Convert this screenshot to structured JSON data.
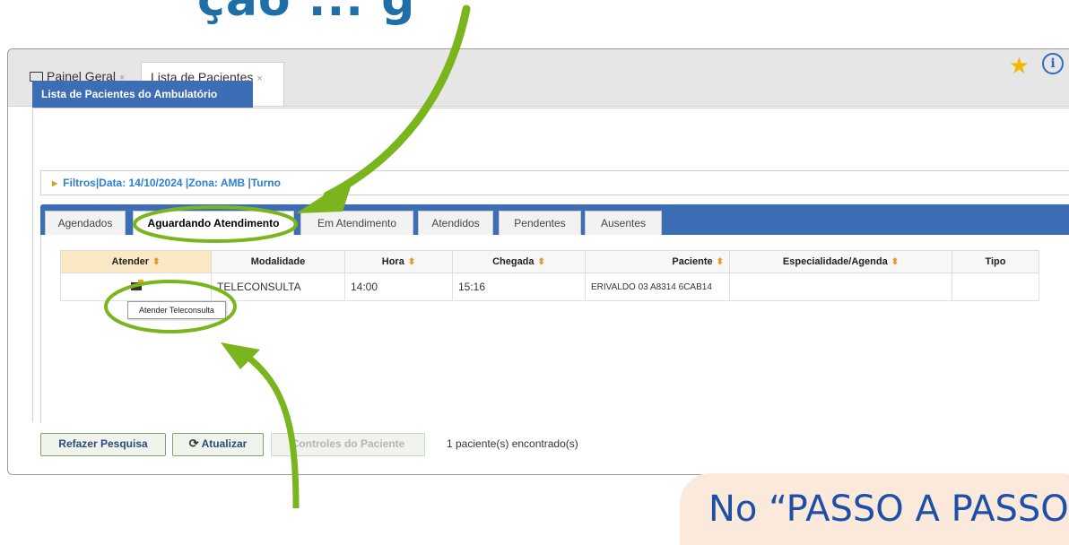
{
  "heading": {
    "text": "ção ... g"
  },
  "window_tabs": [
    {
      "label": "Painel Geral",
      "close": "×"
    },
    {
      "label": "Lista de Pacientes",
      "close": "×"
    }
  ],
  "panel": {
    "title": "Lista de Pacientes do Ambulatório",
    "filters": "Filtros|Data: 14/10/2024 |Zona: AMB |Turno"
  },
  "inner_tabs": [
    "Agendados",
    "Aguardando Atendimento",
    "Em Atendimento",
    "Atendidos",
    "Pendentes",
    "Ausentes"
  ],
  "table": {
    "headers": [
      "Atender",
      "Modalidade",
      "Hora",
      "Chegada",
      "Paciente",
      "Especialidade/Agenda",
      "Tipo"
    ],
    "rows": [
      {
        "modalidade": "TELECONSULTA",
        "hora": "14:00",
        "chegada": "15:16",
        "paciente": "ERIVALDO 03 A8314 6CAB14",
        "especialidade": "",
        "tipo": ""
      }
    ]
  },
  "tooltip": "Atender Teleconsulta",
  "buttons": {
    "refazer": "Refazer Pesquisa",
    "atualizar": "Atualizar",
    "controles": "Controles do Paciente"
  },
  "result_count": "1 paciente(s) encontrado(s)",
  "bubble": "No “PASSO A PASSO",
  "colors": {
    "accent": "#3d6db5",
    "arrow": "#7ab51d",
    "link": "#2d7fd0"
  }
}
